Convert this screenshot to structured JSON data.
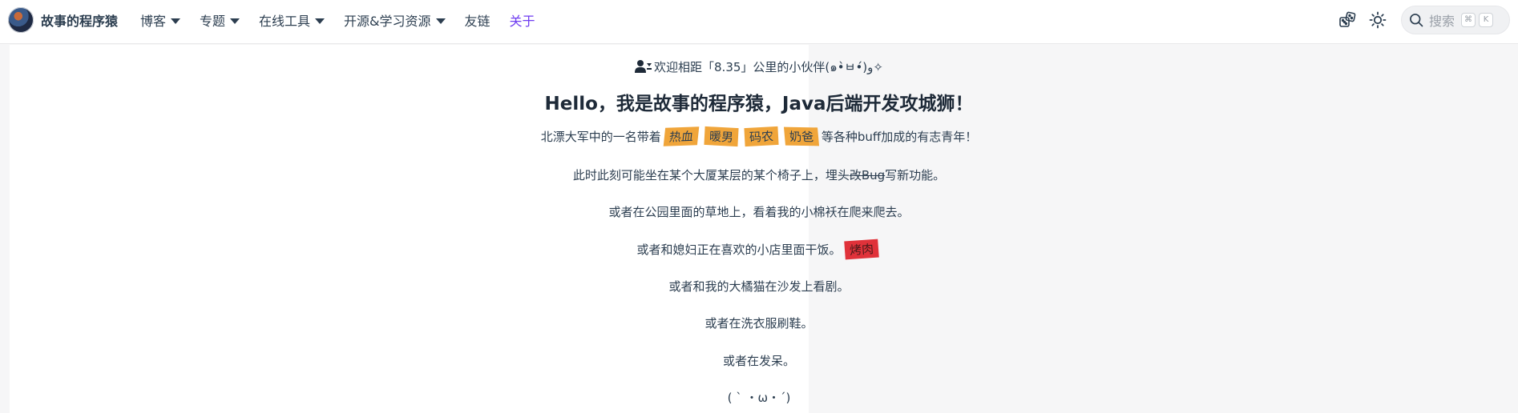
{
  "header": {
    "site_name": "故事的程序猿",
    "nav": [
      {
        "label": "博客",
        "dropdown": true
      },
      {
        "label": "专题",
        "dropdown": true
      },
      {
        "label": "在线工具",
        "dropdown": true
      },
      {
        "label": "开源&学习资源",
        "dropdown": true
      },
      {
        "label": "友链",
        "dropdown": false
      },
      {
        "label": "关于",
        "dropdown": false,
        "active": true
      }
    ],
    "search": {
      "placeholder": "搜索",
      "kbd1": "⌘",
      "kbd2": "K"
    },
    "accent_color": "#6e3cf0"
  },
  "hero": {
    "welcome_prefix": "欢迎相距「",
    "distance": "8.35",
    "welcome_suffix": "」公里的小伙伴(๑•̀ㅂ•́)و✧",
    "title": "Hello，我是故事的程序猿，Java后端开发攻城狮！",
    "intro_prefix": "北漂大军中的一名带着",
    "tags": [
      "热血",
      "暖男",
      "码农",
      "奶爸"
    ],
    "intro_suffix": "等各种buff加成的有志青年！",
    "line2_prefix": "此时此刻可能坐在某个大厦某层的某个椅子上，埋头",
    "line2_strike": "改Bug",
    "line2_suffix": "写新功能。",
    "line3": "或者在公园里面的草地上，看着我的小棉袄在爬来爬去。",
    "line4_prefix": "或者和媳妇正在喜欢的小店里面干饭。",
    "line4_tag": "烤肉",
    "line5": "或者和我的大橘猫在沙发上看剧。",
    "line6": "或者在洗衣服刷鞋。",
    "line7": "或者在发呆。",
    "line8": "( ` ・ω・´)"
  }
}
